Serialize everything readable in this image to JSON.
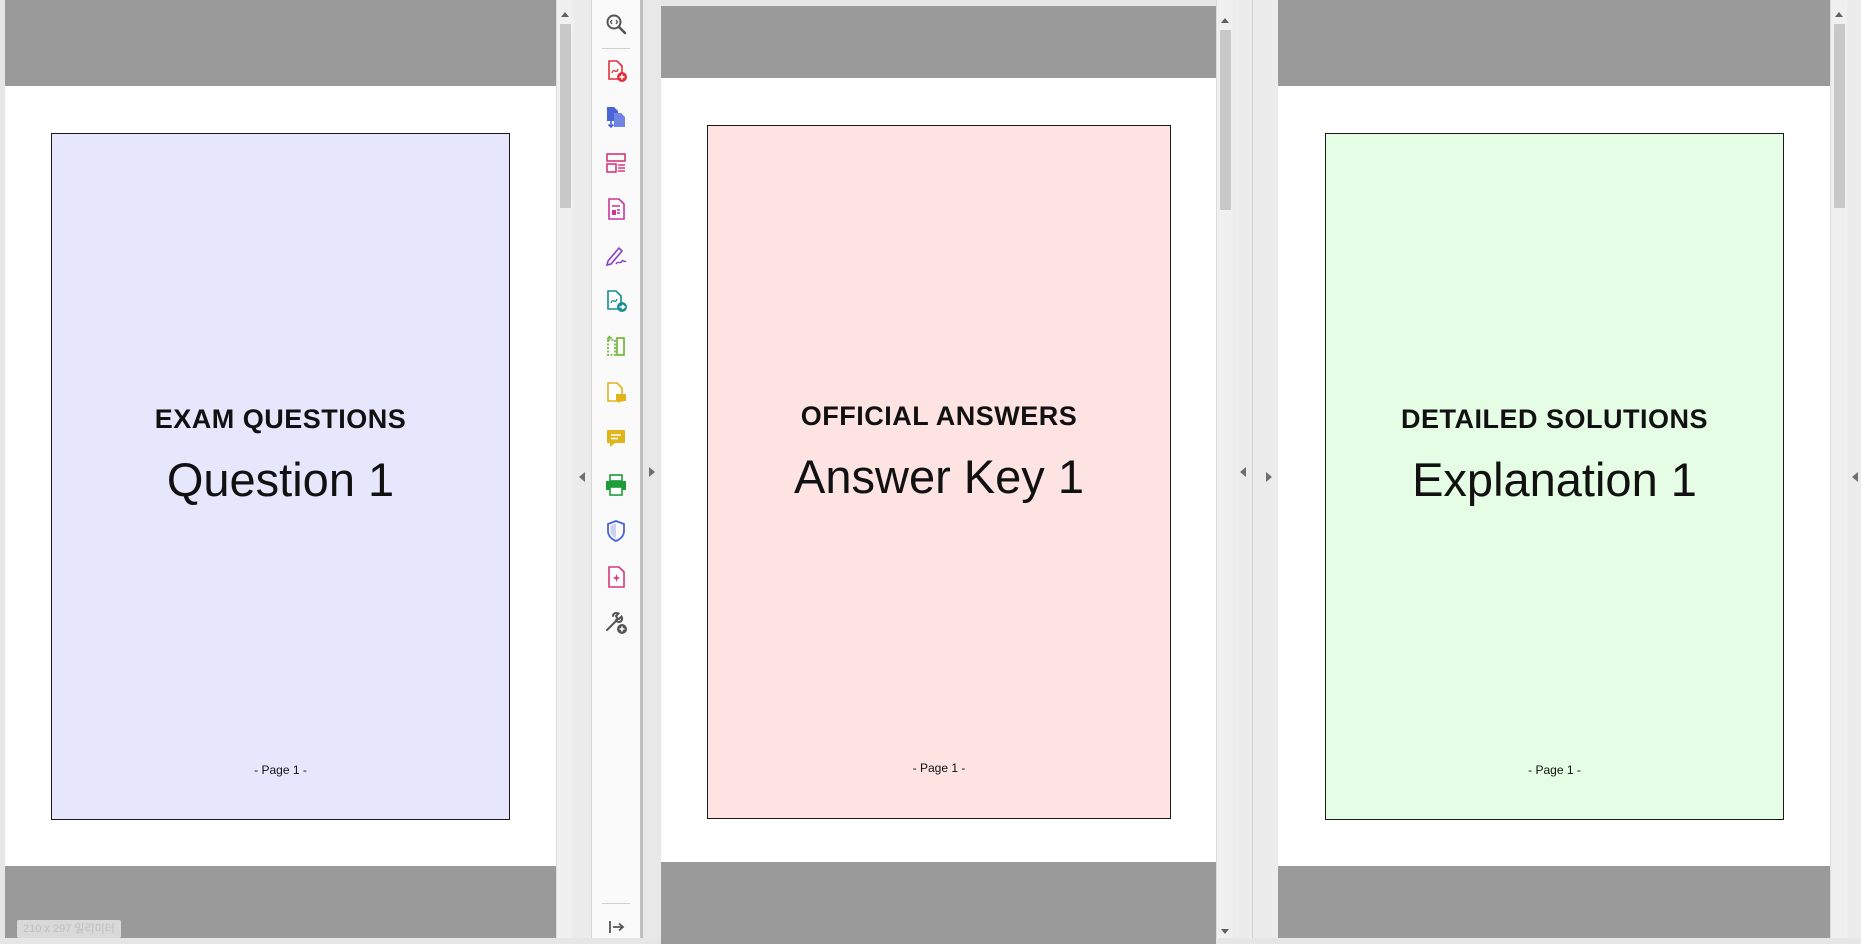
{
  "panes": [
    {
      "heading": "EXAM QUESTIONS",
      "subheading": "Question 1",
      "footer": "- Page 1 -",
      "tint": "#e6e6fd"
    },
    {
      "heading": "OFFICIAL ANSWERS",
      "subheading": "Answer Key 1",
      "footer": "- Page 1 -",
      "tint": "#fee3e3"
    },
    {
      "heading": "DETAILED SOLUTIONS",
      "subheading": "Explanation 1",
      "footer": "- Page 1 -",
      "tint": "#e4fde4"
    }
  ],
  "tools": [
    {
      "icon": "zoom-icon"
    },
    {
      "icon": "create-pdf-icon",
      "color": "#e0303a"
    },
    {
      "icon": "export-pdf-icon",
      "color": "#4a63d6"
    },
    {
      "icon": "organize-pages-icon",
      "color": "#d6377c"
    },
    {
      "icon": "edit-pdf-icon",
      "color": "#c8359d"
    },
    {
      "icon": "fill-sign-icon",
      "color": "#8b3fc8"
    },
    {
      "icon": "send-for-review-icon",
      "color": "#168f8f"
    },
    {
      "icon": "compare-files-icon",
      "color": "#67b22c"
    },
    {
      "icon": "comment-file-icon",
      "color": "#e1b21a"
    },
    {
      "icon": "comment-icon",
      "color": "#e0b51b"
    },
    {
      "icon": "print-production-icon",
      "color": "#1f9c3a"
    },
    {
      "icon": "protect-icon",
      "color": "#4a63d6"
    },
    {
      "icon": "rich-media-icon",
      "color": "#d6377c"
    },
    {
      "icon": "more-tools-icon",
      "color": "#555555"
    }
  ],
  "status": {
    "chip_text": "210 x 297 밀리미터"
  }
}
